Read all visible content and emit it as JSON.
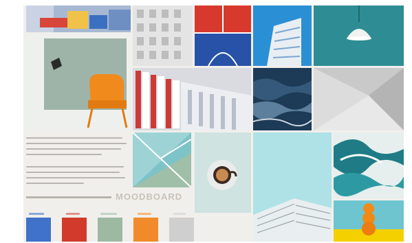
{
  "board": {
    "title": "MOODBOARD",
    "description_text": [],
    "palette": [
      {
        "name": "blue",
        "color": "#3f72c8"
      },
      {
        "name": "red",
        "color": "#d23b2b"
      },
      {
        "name": "sage",
        "color": "#9db9a2"
      },
      {
        "name": "orange",
        "color": "#f18a2b"
      },
      {
        "name": "grey",
        "color": "#cfcfcf"
      }
    ]
  },
  "colors": {
    "background": "#f1efec",
    "accent_orange": "#f18a2b",
    "sky_blue": "#2b8fd6",
    "teal": "#2e8d94"
  }
}
